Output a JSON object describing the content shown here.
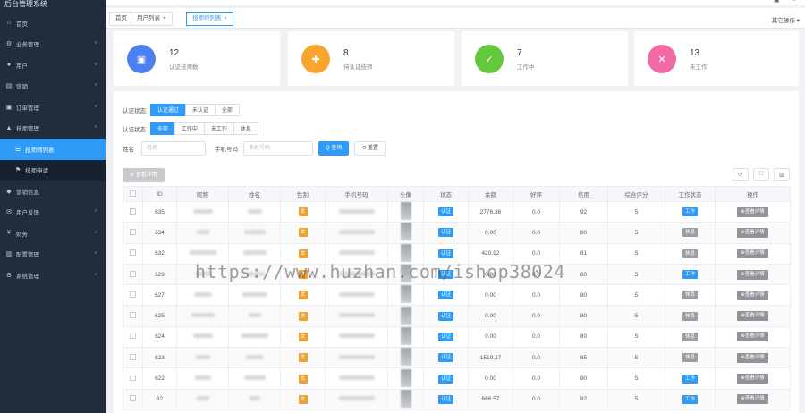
{
  "app": {
    "title": "后台管理系统"
  },
  "sidebar": {
    "items": [
      {
        "label": "首页",
        "icon": "home-icon",
        "glyph": "⌂",
        "chevron": false
      },
      {
        "label": "业务管理",
        "icon": "gear-icon",
        "glyph": "⚙",
        "chevron": true
      },
      {
        "label": "用户",
        "icon": "user-icon",
        "glyph": "●",
        "chevron": true
      },
      {
        "label": "营销",
        "icon": "megaphone-icon",
        "glyph": "▤",
        "chevron": true
      },
      {
        "label": "订单管理",
        "icon": "order-icon",
        "glyph": "▣",
        "chevron": true
      },
      {
        "label": "技师管理",
        "icon": "tech-icon",
        "glyph": "▲",
        "chevron": true,
        "open": true
      },
      {
        "label": "技师师列表",
        "icon": "list-icon",
        "glyph": "☰",
        "sub": true,
        "active": true
      },
      {
        "label": "技师申请",
        "icon": "apply-icon",
        "glyph": "⚑",
        "sub": true
      },
      {
        "label": "营销信息",
        "icon": "info-icon",
        "glyph": "◆",
        "chevron": false
      },
      {
        "label": "用户反馈",
        "icon": "feedback-icon",
        "glyph": "✉",
        "chevron": true
      },
      {
        "label": "财务",
        "icon": "finance-icon",
        "glyph": "¥",
        "chevron": true
      },
      {
        "label": "配置管理",
        "icon": "config-icon",
        "glyph": "▥",
        "chevron": true
      },
      {
        "label": "系统管理",
        "icon": "system-icon",
        "glyph": "⚙",
        "chevron": true
      }
    ]
  },
  "tabs": [
    {
      "label": "首页",
      "closable": false,
      "active": false
    },
    {
      "label": "用户列表",
      "closable": true,
      "active": false
    },
    {
      "label": "技师师列表",
      "closable": true,
      "active": true
    }
  ],
  "other_ops": "其它操作 ▾",
  "stats": [
    {
      "value": "12",
      "label": "认证技师数",
      "color": "#4c7ff0",
      "icon": "bag-icon",
      "glyph": "▣"
    },
    {
      "value": "8",
      "label": "待认证技师",
      "color": "#f7a52f",
      "icon": "puzzle-icon",
      "glyph": "✚"
    },
    {
      "value": "7",
      "label": "工作中",
      "color": "#63c83a",
      "icon": "doc-check-icon",
      "glyph": "✓"
    },
    {
      "value": "13",
      "label": "未工作",
      "color": "#f16aa5",
      "icon": "doc-x-icon",
      "glyph": "✕"
    }
  ],
  "filters": {
    "cert_label": "认证状态:",
    "cert_options": [
      "认证通过",
      "未认证",
      "全部"
    ],
    "cert_selected": 0,
    "work_label": "认证状态:",
    "work_options": [
      "全部",
      "工作中",
      "未工作",
      "休息"
    ],
    "work_selected": 0,
    "name_label": "姓名",
    "name_placeholder": "姓名",
    "phone_label": "手机号码",
    "phone_placeholder": "手机号码",
    "search_btn": "Q 查询",
    "reset_btn": "⟲ 重置"
  },
  "batch_btn": "⊕ 查看详情",
  "table": {
    "headers": [
      "",
      "ID",
      "昵称",
      "姓名",
      "性别",
      "手机号码",
      "头像",
      "状态",
      "余额",
      "好评",
      "信用",
      "综合评分",
      "工作状态",
      "操作"
    ],
    "rows": [
      {
        "id": "635",
        "gender": "女",
        "status": "认证",
        "balance": "2776.36",
        "good": "0.0",
        "credit": "92",
        "score": "5",
        "work": "工作",
        "work_tag": "blue"
      },
      {
        "id": "634",
        "gender": "女",
        "status": "认证",
        "balance": "0.00",
        "good": "0.0",
        "credit": "80",
        "score": "5",
        "work": "休息",
        "work_tag": "grey"
      },
      {
        "id": "632",
        "gender": "女",
        "status": "认证",
        "balance": "420.92",
        "good": "0.0",
        "credit": "81",
        "score": "5",
        "work": "休息",
        "work_tag": "grey"
      },
      {
        "id": "629",
        "gender": "女",
        "status": "认证",
        "balance": "0.00",
        "good": "0.0",
        "credit": "80",
        "score": "5",
        "work": "工作",
        "work_tag": "blue"
      },
      {
        "id": "627",
        "gender": "女",
        "status": "认证",
        "balance": "0.00",
        "good": "0.0",
        "credit": "80",
        "score": "5",
        "work": "休息",
        "work_tag": "grey"
      },
      {
        "id": "625",
        "gender": "女",
        "status": "认证",
        "balance": "0.00",
        "good": "0.0",
        "credit": "80",
        "score": "5",
        "work": "休息",
        "work_tag": "grey"
      },
      {
        "id": "624",
        "gender": "女",
        "status": "认证",
        "balance": "0.00",
        "good": "0.0",
        "credit": "80",
        "score": "5",
        "work": "休息",
        "work_tag": "grey"
      },
      {
        "id": "623",
        "gender": "女",
        "status": "认证",
        "balance": "1519.37",
        "good": "0.0",
        "credit": "85",
        "score": "5",
        "work": "休息",
        "work_tag": "grey"
      },
      {
        "id": "622",
        "gender": "女",
        "status": "认证",
        "balance": "0.00",
        "good": "0.0",
        "credit": "80",
        "score": "5",
        "work": "工作",
        "work_tag": "blue"
      },
      {
        "id": "62",
        "gender": "女",
        "status": "认证",
        "balance": "666.57",
        "good": "0.0",
        "credit": "82",
        "score": "5",
        "work": "工作",
        "work_tag": "blue"
      }
    ],
    "action_label": "⊕查看详情"
  },
  "watermark": "https://www.huzhan.com/ishop38024"
}
